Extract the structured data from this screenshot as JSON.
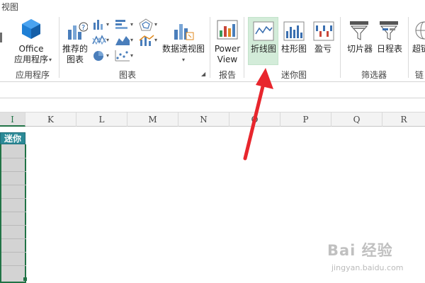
{
  "ribbon": {
    "tab_view": "视图",
    "office_app": {
      "line1": "Office",
      "line2": "应用程序"
    },
    "group_apps": "应用程序",
    "recommended_chart": {
      "line1": "推荐的",
      "line2": "图表"
    },
    "pivot_chart": "数据透视图",
    "group_charts": "图表",
    "power_view": {
      "line1": "Power",
      "line2": "View"
    },
    "group_reports": "报告",
    "sparkline_line": "折线图",
    "sparkline_column": "柱形图",
    "sparkline_winloss": "盈亏",
    "group_sparklines": "迷你图",
    "slicer": "切片器",
    "timeline": "日程表",
    "group_filters": "筛选器",
    "hyperlink_partial": "超链",
    "group_links_partial": "链"
  },
  "sheet": {
    "columns": [
      "I",
      "K",
      "L",
      "M",
      "N",
      "O",
      "P",
      "Q",
      "R"
    ],
    "header_cell": "迷你图"
  },
  "colors": {
    "accent_green": "#217346",
    "line_highlight": "#d3ecd9",
    "header_fill": "#2c8a97",
    "annotation_arrow": "#e8262d"
  },
  "watermark": {
    "text": "Bai 经验",
    "sub": "jingyan.baidu.com"
  }
}
